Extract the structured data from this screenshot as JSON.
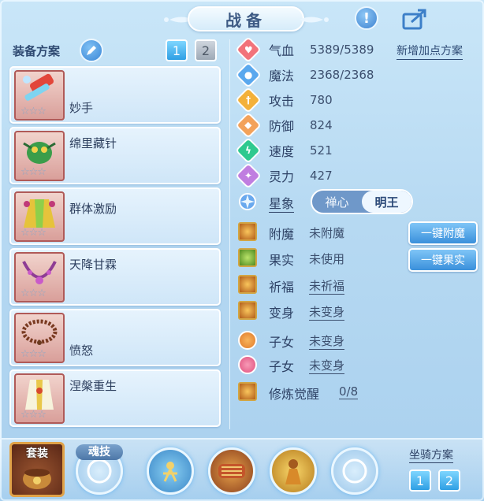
{
  "header": {
    "title": "战备"
  },
  "equipment": {
    "title": "装备方案",
    "tabs": [
      "1",
      "2"
    ],
    "active_tab": "1",
    "items": [
      {
        "name": "妙手",
        "stars": "☆☆☆",
        "icon": "ice-lolly-weapon-icon",
        "name_pos": "bottom"
      },
      {
        "name": "绵里藏针",
        "stars": "☆☆☆",
        "icon": "green-creature-icon",
        "name_pos": "top"
      },
      {
        "name": "群体激励",
        "stars": "☆☆☆",
        "icon": "golden-robe-icon",
        "name_pos": "bottom"
      },
      {
        "name": "天降甘霖",
        "stars": "☆☆☆",
        "icon": "purple-necklace-icon",
        "name_pos": "top"
      },
      {
        "name": "愤怒",
        "stars": "☆☆☆",
        "icon": "bead-necklace-icon",
        "name_pos": "bottom"
      },
      {
        "name": "涅槃重生",
        "stars": "☆☆☆",
        "icon": "white-robe-icon",
        "name_pos": "top"
      }
    ]
  },
  "stats": {
    "add_plan_label": "新增加点方案",
    "rows": [
      {
        "label": "气血",
        "value": "5389/5389",
        "color": "#f2737a",
        "icon": "heart-icon",
        "glyph": "♥"
      },
      {
        "label": "魔法",
        "value": "2368/2368",
        "color": "#5aa8ee",
        "icon": "mana-icon",
        "glyph": "●"
      },
      {
        "label": "攻击",
        "value": "780",
        "color": "#f3b13a",
        "icon": "sword-icon",
        "glyph": "†"
      },
      {
        "label": "防御",
        "value": "824",
        "color": "#f3a25a",
        "icon": "shield-icon",
        "glyph": "◆"
      },
      {
        "label": "速度",
        "value": "521",
        "color": "#2fc98f",
        "icon": "lightning-icon",
        "glyph": "ϟ"
      },
      {
        "label": "灵力",
        "value": "427",
        "color": "#c07ee0",
        "icon": "spirit-icon",
        "glyph": "✦"
      }
    ]
  },
  "constellation": {
    "label": "星象",
    "options": [
      "禅心",
      "明王"
    ],
    "active": "明王"
  },
  "buffs": {
    "enchant": {
      "label": "附魔",
      "value": "未附魔"
    },
    "fruit": {
      "label": "果实",
      "value": "未使用"
    },
    "blessing": {
      "label": "祈福",
      "value": "未祈福"
    },
    "transform": {
      "label": "变身",
      "value": "未变身"
    },
    "child1": {
      "label": "子女",
      "value": "未变身"
    },
    "child2": {
      "label": "子女",
      "value": "未变身"
    },
    "awaken": {
      "label": "修炼觉醒",
      "value": "0/8"
    }
  },
  "actions": {
    "enchant_button": "一键附魔",
    "fruit_button": "一键果实"
  },
  "bottom": {
    "suit_label": "套装",
    "soul_skill_label": "魂技",
    "mount_title": "坐骑方案",
    "mount_tabs": [
      "1",
      "2"
    ]
  }
}
